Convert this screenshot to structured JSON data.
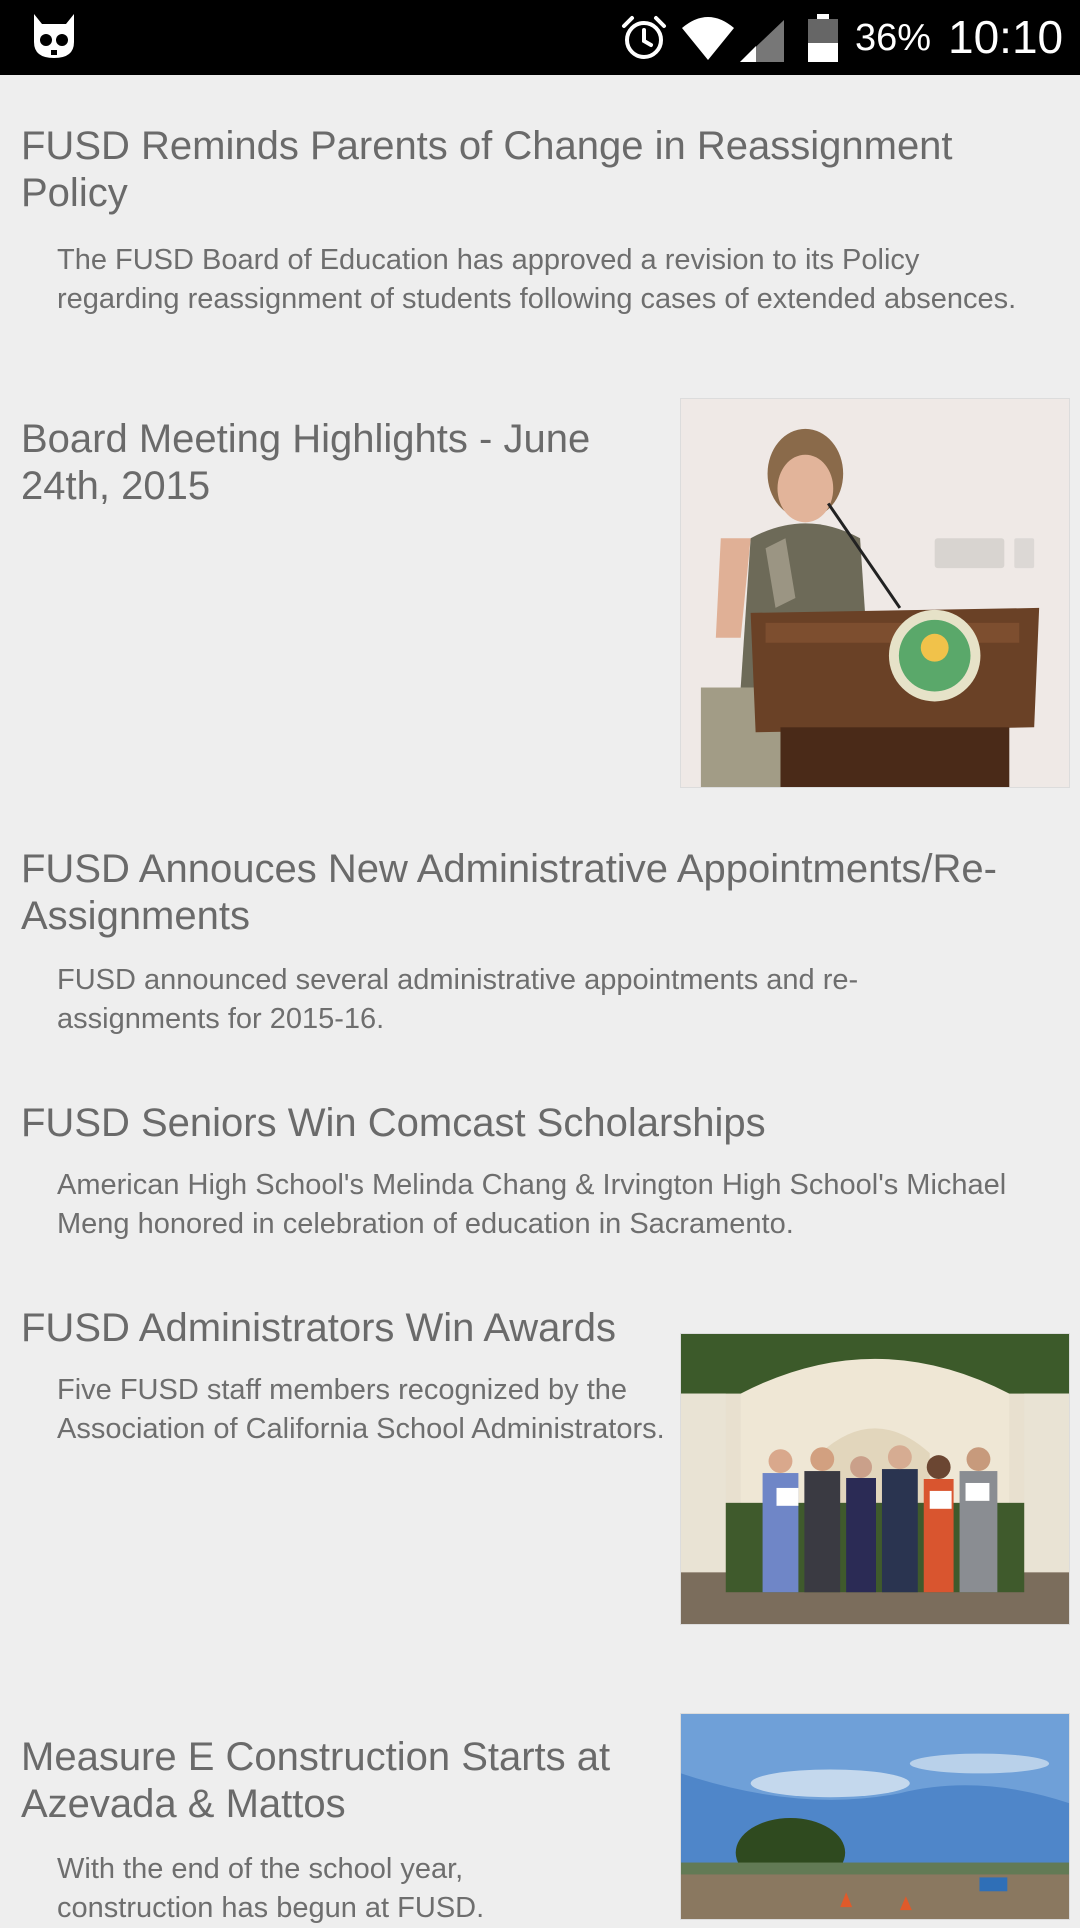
{
  "status_bar": {
    "app_icon": "cyanogen-cat-icon",
    "alarm_icon": "alarm-clock-icon",
    "wifi_icon": "wifi-icon",
    "signal_icon": "cell-signal-icon",
    "battery_icon": "battery-icon",
    "battery_percent": "36%",
    "time": "10:10"
  },
  "feed": [
    {
      "title": "FUSD Reminds Parents of Change in Reassignment Policy",
      "description": "The FUSD Board of Education has approved a revision to its Policy regarding reassignment of students following cases of extended absences."
    },
    {
      "title": "Board Meeting Highlights - June 24th, 2015",
      "image": "photo-woman-at-podium"
    },
    {
      "title": "FUSD Annouces New Administrative Appointments/Re-Assignments",
      "description": "FUSD announced several administrative appointments and re-assignments for 2015-16."
    },
    {
      "title": "FUSD Seniors Win Comcast Scholarships",
      "description": "American High School's Melinda Chang & Irvington High School's Michael Meng honored in celebration of education in Sacramento."
    },
    {
      "title": "FUSD Administrators Win Awards",
      "description": "Five FUSD staff members recognized by the Association of California School Administrators.",
      "image": "photo-group-with-certificates"
    },
    {
      "title": "Measure E Construction Starts at Azevada & Mattos",
      "description": "With the end of the school year, construction has begun at FUSD.",
      "image": "photo-construction-site"
    }
  ]
}
